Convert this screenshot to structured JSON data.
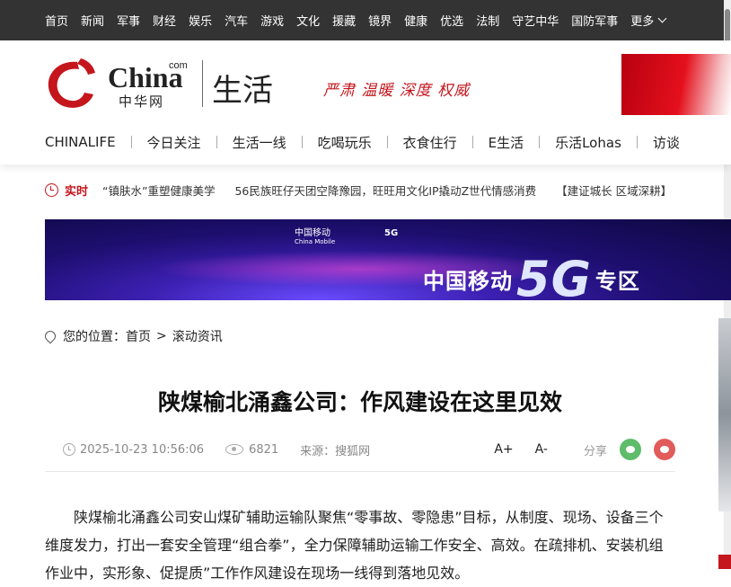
{
  "topnav": {
    "items": [
      "首页",
      "新闻",
      "军事",
      "财经",
      "娱乐",
      "汽车",
      "游戏",
      "文化",
      "援藏",
      "镜界",
      "健康",
      "优选",
      "法制",
      "守艺中华",
      "国防军事"
    ],
    "more_label": "更多"
  },
  "header": {
    "logo_text": "China",
    "logo_com": "com",
    "logo_cn": "中华网",
    "channel_title": "生活",
    "slogan": "严肃 温暖 深度 权威"
  },
  "subnav": [
    "CHINALIFE",
    "今日关注",
    "生活一线",
    "吃喝玩乐",
    "衣食住行",
    "E生活",
    "乐活Lohas",
    "访谈"
  ],
  "realtime": {
    "label": "实时",
    "items": [
      "“镇肤水”重塑健康美学",
      "56民族旺仔天团空降豫园，旺旺用文化IP撬动Z世代情感消费",
      "【建证城长 区域深耕】"
    ]
  },
  "ad": {
    "brand_cn": "中国移动",
    "brand_en": "China Mobile",
    "tag": "5G",
    "headline_left": "中国移动",
    "headline_big": "5G",
    "headline_right": "专区"
  },
  "breadcrumb": {
    "prefix": "您的位置：",
    "home": "首页",
    "arrow": ">",
    "section": "滚动资讯"
  },
  "article": {
    "title": "陕煤榆北涌鑫公司：作风建设在这里见效",
    "datetime": "2025-10-23 10:56:06",
    "views": "6821",
    "source": "来源：搜狐网",
    "font_up": "A+",
    "font_down": "A-",
    "share_label": "分享",
    "body": "陕煤榆北涌鑫公司安山煤矿辅助运输队聚焦“零事故、零隐患”目标，从制度、现场、设备三个维度发力，打出一套安全管理“组合拳”，全力保障辅助运输工作安全、高效。在疏排机、安装机组作业中，实形象、促提质”工作作风建设在现场一线得到落地见效。"
  },
  "colors": {
    "accent_red": "#c4161c",
    "topnav_bg": "#333333",
    "wechat": "#5fbc6a",
    "weibo": "#e25b5b"
  }
}
